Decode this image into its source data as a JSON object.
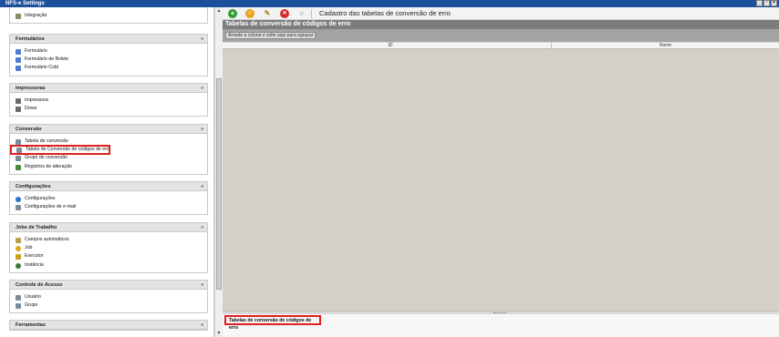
{
  "window": {
    "title": "NFS-e Settings",
    "controls": [
      "_",
      "▫",
      "×"
    ]
  },
  "sidebar": {
    "top_item": {
      "label": "Integração",
      "icon": "integration-icon"
    },
    "groups": [
      {
        "title": "Formulários",
        "items": [
          {
            "label": "Formulário",
            "icon": "form-icon",
            "color": "#4a7fd4"
          },
          {
            "label": "Formulário de Boleto",
            "icon": "form-icon",
            "color": "#4a7fd4"
          },
          {
            "label": "Formulário Cold",
            "icon": "form-icon",
            "color": "#4a7fd4"
          }
        ]
      },
      {
        "title": "Impressoras",
        "items": [
          {
            "label": "Impressora",
            "icon": "printer-icon",
            "color": "#6a6a6a"
          },
          {
            "label": "Driver",
            "icon": "driver-icon",
            "color": "#6a6a6a"
          }
        ]
      },
      {
        "title": "Conversão",
        "items": [
          {
            "label": "Tabela de conversão",
            "icon": "conversion-table-icon",
            "color": "#7a8b9a"
          },
          {
            "label": "Tabela de Conversão de códigos de erro",
            "icon": "conversion-table-icon",
            "color": "#7a8b9a",
            "highlighted": true
          },
          {
            "label": "Grupo de conversão",
            "icon": "conversion-group-icon",
            "color": "#7a8b9a"
          },
          {
            "label": "Registros de alteração",
            "icon": "change-log-icon",
            "color": "#4f8a3a"
          }
        ]
      },
      {
        "title": "Configurações",
        "items": [
          {
            "label": "Configurações",
            "icon": "settings-icon",
            "color": "#2a6fd1"
          },
          {
            "label": "Configurações de e-mail",
            "icon": "email-settings-icon",
            "color": "#7a8b9a"
          }
        ]
      },
      {
        "title": "Jobs de Trabalho",
        "items": [
          {
            "label": "Campos automáticos",
            "icon": "auto-fields-icon",
            "color": "#b9a04a"
          },
          {
            "label": "Job",
            "icon": "job-icon",
            "color": "#e6a21a"
          },
          {
            "label": "Executor",
            "icon": "executor-icon",
            "color": "#c9a21a"
          },
          {
            "label": "Instância",
            "icon": "instance-icon",
            "color": "#3a7a3a"
          }
        ]
      },
      {
        "title": "Controle de Acesso",
        "items": [
          {
            "label": "Usuário",
            "icon": "user-icon",
            "color": "#7a8b9a"
          },
          {
            "label": "Grupo",
            "icon": "group-icon",
            "color": "#7a8b9a"
          }
        ]
      },
      {
        "title": "Ferramentas",
        "items": []
      }
    ],
    "collapse_glyph": "»"
  },
  "toolbar": {
    "title": "Cadastro das tabelas de conversão de erro",
    "buttons": [
      {
        "name": "add-icon",
        "glyph": "+",
        "color": "#2f9e2f"
      },
      {
        "name": "edit-icon",
        "glyph": "☺",
        "color": "#e6a21a"
      },
      {
        "name": "tools-icon",
        "glyph": "✎",
        "color": "#b08a3a"
      },
      {
        "name": "delete-icon",
        "glyph": "✕",
        "color": "#d42a2a"
      },
      {
        "name": "search-icon",
        "glyph": "⌕",
        "color": "#b8b8b8"
      }
    ]
  },
  "main": {
    "title": "Tabelas de conversão de códigos de erro",
    "groupby_hint": "Arraste a coluna e solte aqui para agrupar",
    "columns": [
      "ID",
      "Nome"
    ]
  },
  "bottom_tab": {
    "label": "Tabelas de conversão de códigos de erro"
  }
}
